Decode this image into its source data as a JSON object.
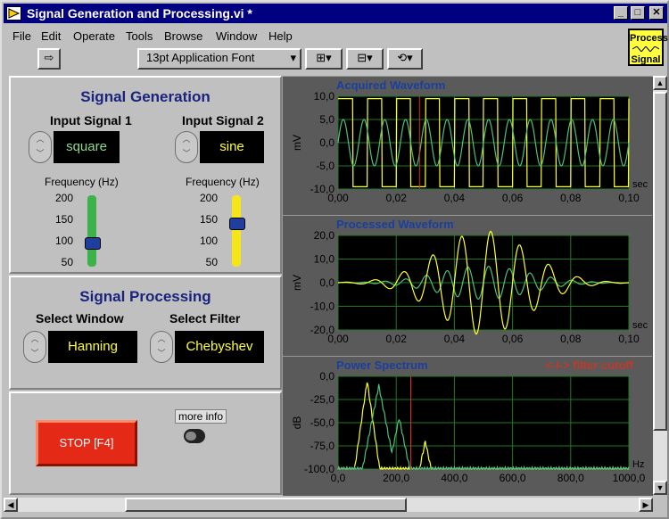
{
  "window": {
    "title": "Signal Generation and Processing.vi *"
  },
  "menu": [
    "File",
    "Edit",
    "Operate",
    "Tools",
    "Browse",
    "Window",
    "Help"
  ],
  "toolbar": {
    "font": "13pt Application Font"
  },
  "process_icon": {
    "line1": "Process",
    "line2": "Signal"
  },
  "generation": {
    "title": "Signal Generation",
    "input1": {
      "label": "Input Signal 1",
      "value": "square",
      "freq_label": "Frequency (Hz)",
      "freq": 100
    },
    "input2": {
      "label": "Input Signal 2",
      "value": "sine",
      "freq_label": "Frequency (Hz)",
      "freq": 140
    },
    "ticks": [
      "200",
      "150",
      "100",
      "50"
    ]
  },
  "processing": {
    "title": "Signal Processing",
    "window": {
      "label": "Select Window",
      "value": "Hanning"
    },
    "filter": {
      "label": "Select Filter",
      "value": "Chebyshev"
    }
  },
  "controls": {
    "stop": "STOP [F4]",
    "more_info": "more info"
  },
  "chart_data": [
    {
      "type": "line",
      "title": "Acquired Waveform",
      "ylabel": "mV",
      "xlabel": "sec",
      "yticks": [
        "10,0",
        "5,0",
        "0,0",
        "-5,0",
        "-10,0"
      ],
      "xticks": [
        "0,00",
        "0,02",
        "0,04",
        "0,06",
        "0,08",
        "0,10"
      ],
      "xlim": [
        0,
        0.1
      ],
      "ylim": [
        -10,
        10
      ],
      "series": [
        {
          "color": "#ffff30",
          "kind": "square",
          "freq": 100,
          "amp": 9.5
        },
        {
          "color": "#4fc080",
          "kind": "sine",
          "freq": 140,
          "amp": 5
        }
      ]
    },
    {
      "type": "line",
      "title": "Processed Waveform",
      "ylabel": "mV",
      "xlabel": "sec",
      "yticks": [
        "20,0",
        "10,0",
        "0,0",
        "-10,0",
        "-20,0"
      ],
      "xticks": [
        "0,00",
        "0,02",
        "0,04",
        "0,06",
        "0,08",
        "0,10"
      ],
      "xlim": [
        0,
        0.1
      ],
      "ylim": [
        -20,
        20
      ]
    },
    {
      "type": "line",
      "title": "Power Spectrum",
      "annotation": "<-l-> filter cutoff",
      "ylabel": "dB",
      "xlabel": "Hz",
      "yticks": [
        "0,0",
        "-25,0",
        "-50,0",
        "-75,0",
        "-100,0"
      ],
      "xticks": [
        "0,0",
        "200,0",
        "400,0",
        "600,0",
        "800,0",
        "1000,0"
      ],
      "xlim": [
        0,
        1000
      ],
      "ylim": [
        -100,
        0
      ],
      "cutoff": 250
    }
  ]
}
